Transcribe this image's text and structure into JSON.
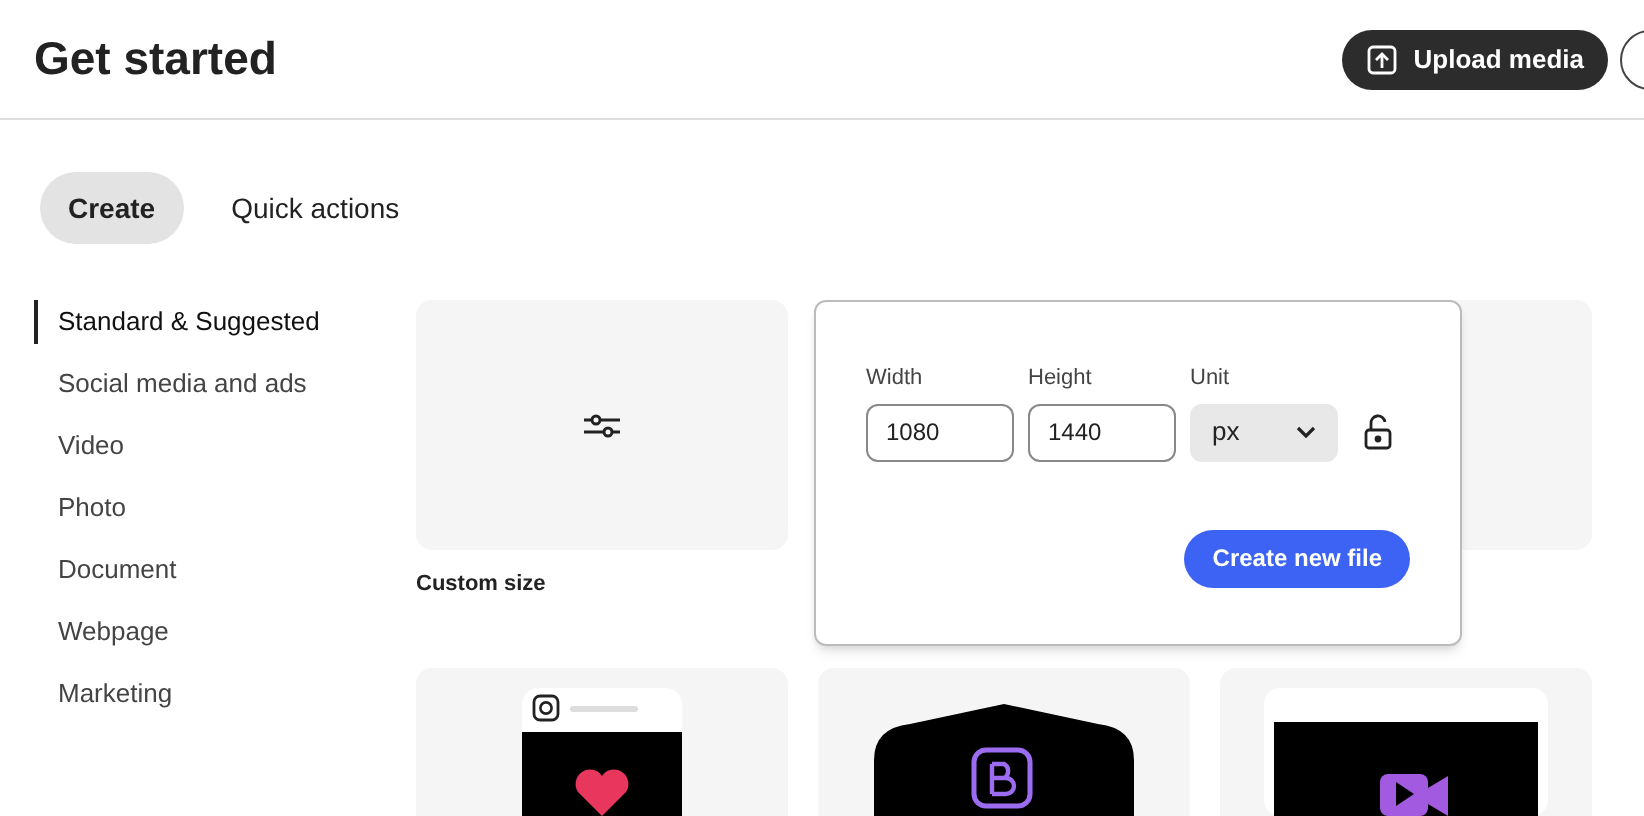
{
  "header": {
    "title": "Get started",
    "upload_button": "Upload media"
  },
  "tabs": [
    {
      "label": "Create",
      "selected": true
    },
    {
      "label": "Quick actions",
      "selected": false
    }
  ],
  "sidebar": {
    "items": [
      {
        "label": "Standard & Suggested",
        "selected": true
      },
      {
        "label": "Social media and ads",
        "selected": false
      },
      {
        "label": "Video",
        "selected": false
      },
      {
        "label": "Photo",
        "selected": false
      },
      {
        "label": "Document",
        "selected": false
      },
      {
        "label": "Webpage",
        "selected": false
      },
      {
        "label": "Marketing",
        "selected": false
      }
    ]
  },
  "cards_row_1": [
    {
      "kind": "custom",
      "label": "Custom size"
    },
    {
      "kind": "hidden"
    },
    {
      "kind": "hidden"
    }
  ],
  "popover": {
    "width_label": "Width",
    "width_value": "1080",
    "height_label": "Height",
    "height_value": "1440",
    "unit_label": "Unit",
    "unit_value": "px",
    "locked": false,
    "button": "Create new file"
  },
  "cards_row_2": [
    {
      "kind": "phone"
    },
    {
      "kind": "shield"
    },
    {
      "kind": "video"
    }
  ]
}
